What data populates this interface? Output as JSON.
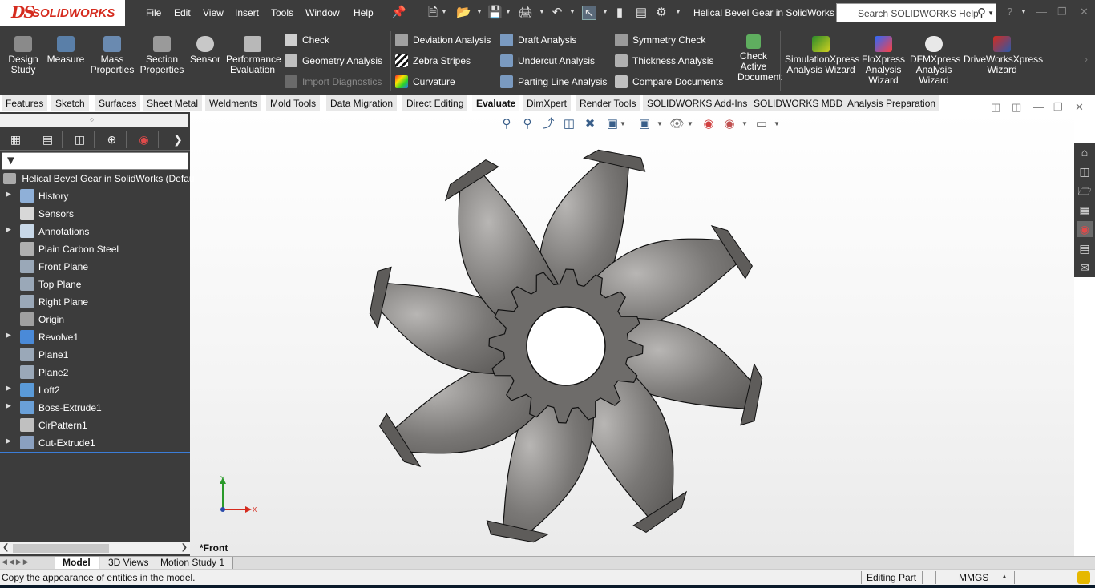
{
  "app": {
    "brand": "SOLIDWORKS",
    "brand_mark": "DS"
  },
  "menu": [
    "File",
    "Edit",
    "View",
    "Insert",
    "Tools",
    "Window",
    "Help"
  ],
  "document_title": "Helical Bevel Gear in SolidWorks",
  "search": {
    "placeholder": "Search SOLIDWORKS Help"
  },
  "ribbon": {
    "design_study": "Design Study",
    "measure": "Measure",
    "mass_properties": "Mass Properties",
    "section_properties": "Section Properties",
    "sensor": "Sensor",
    "performance_evaluation": "Performance Evaluation",
    "check": "Check",
    "geometry_analysis": "Geometry Analysis",
    "import_diagnostics": "Import Diagnostics",
    "deviation_analysis": "Deviation Analysis",
    "zebra_stripes": "Zebra Stripes",
    "curvature": "Curvature",
    "draft_analysis": "Draft Analysis",
    "undercut_analysis": "Undercut Analysis",
    "parting_line_analysis": "Parting Line Analysis",
    "symmetry_check": "Symmetry Check",
    "thickness_analysis": "Thickness Analysis",
    "compare_documents": "Compare Documents",
    "check_active_document": "Check Active Document",
    "simulationxpress": "SimulationXpress Analysis Wizard",
    "floxpress": "FloXpress Analysis Wizard",
    "dfmxpress": "DFMXpress Analysis Wizard",
    "driveworksxpress": "DriveWorksXpress Wizard"
  },
  "tabs": [
    "Features",
    "Sketch",
    "Surfaces",
    "Sheet Metal",
    "Weldments",
    "Mold Tools",
    "Data Migration",
    "Direct Editing",
    "Evaluate",
    "DimXpert",
    "Render Tools",
    "SOLIDWORKS Add-Ins",
    "SOLIDWORKS MBD",
    "Analysis Preparation"
  ],
  "active_tab": "Evaluate",
  "tree": {
    "root": "Helical Bevel Gear in SolidWorks  (Defau",
    "items": [
      {
        "label": "History",
        "icon": "history-icon",
        "expandable": true
      },
      {
        "label": "Sensors",
        "icon": "sensor-icon",
        "expandable": false
      },
      {
        "label": "Annotations",
        "icon": "annotation-icon",
        "expandable": true
      },
      {
        "label": "Plain Carbon Steel",
        "icon": "material-icon",
        "expandable": false
      },
      {
        "label": "Front Plane",
        "icon": "plane-icon",
        "expandable": false
      },
      {
        "label": "Top Plane",
        "icon": "plane-icon",
        "expandable": false
      },
      {
        "label": "Right Plane",
        "icon": "plane-icon",
        "expandable": false
      },
      {
        "label": "Origin",
        "icon": "origin-icon",
        "expandable": false
      },
      {
        "label": "Revolve1",
        "icon": "revolve-icon",
        "expandable": true
      },
      {
        "label": "Plane1",
        "icon": "plane-icon",
        "expandable": false
      },
      {
        "label": "Plane2",
        "icon": "plane-icon",
        "expandable": false
      },
      {
        "label": "Loft2",
        "icon": "loft-icon",
        "expandable": true
      },
      {
        "label": "Boss-Extrude1",
        "icon": "extrude-icon",
        "expandable": true
      },
      {
        "label": "CirPattern1",
        "icon": "circular-pattern-icon",
        "expandable": false
      },
      {
        "label": "Cut-Extrude1",
        "icon": "cut-extrude-icon",
        "expandable": true
      }
    ]
  },
  "viewport": {
    "view_name": "*Front",
    "triad_x": "X",
    "triad_y": "Y",
    "tooth_count": 8
  },
  "bottom_tabs": [
    "Model",
    "3D Views",
    "Motion Study 1"
  ],
  "active_bottom_tab": "Model",
  "status": {
    "message": "Copy the appearance of entities in the model.",
    "mode": "Editing Part",
    "units": "MMGS"
  },
  "colors": {
    "chrome": "#3c3c3c",
    "brand_red": "#d52b1e",
    "gear": "#6e6c6a",
    "rollback_bar": "#3b7dd8"
  }
}
